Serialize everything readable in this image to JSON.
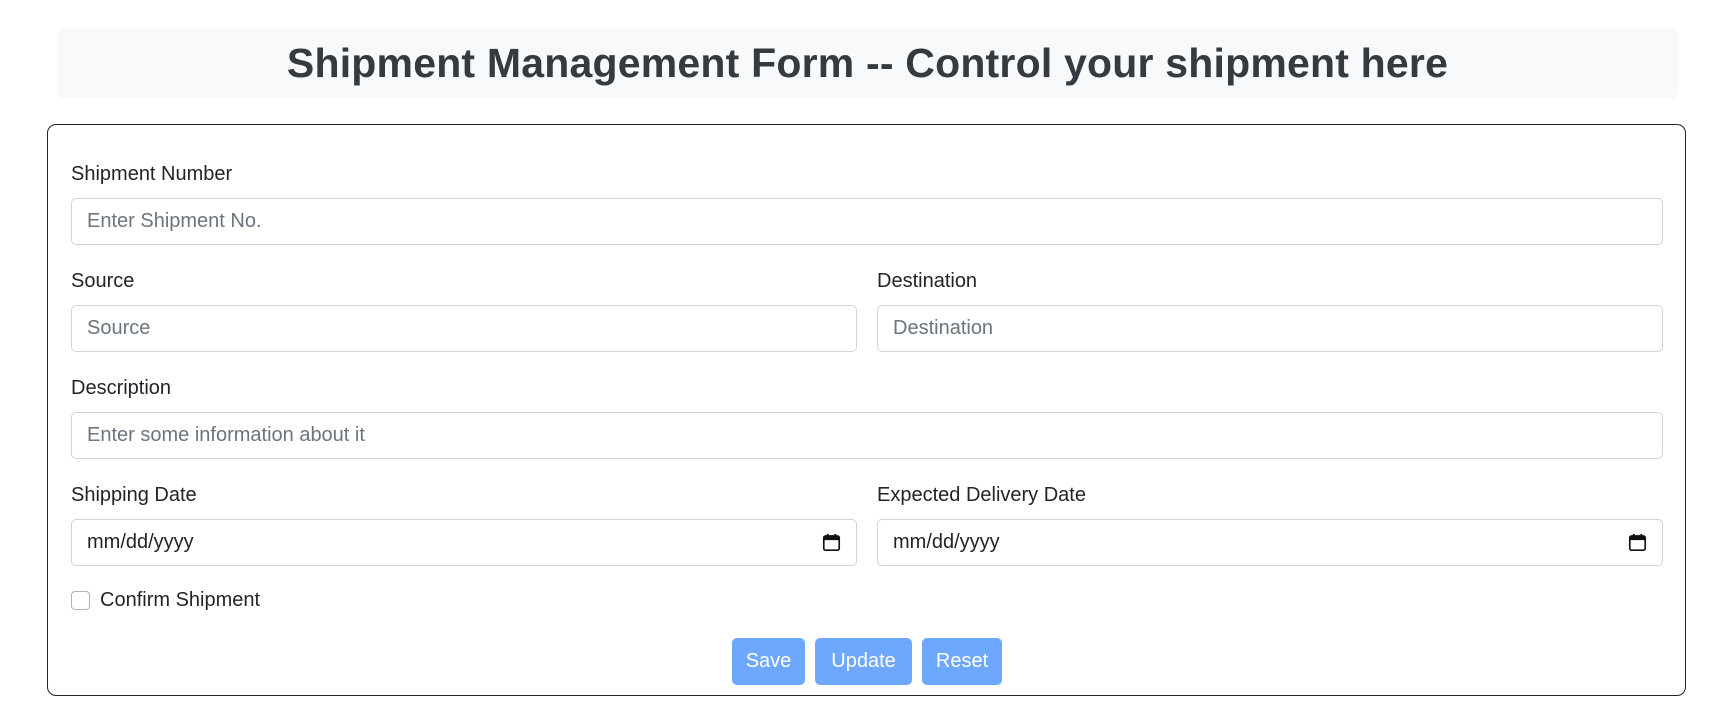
{
  "header": {
    "title": "Shipment Management Form -- Control your shipment here"
  },
  "form": {
    "shipment_number": {
      "label": "Shipment Number",
      "placeholder": "Enter Shipment No.",
      "value": ""
    },
    "source": {
      "label": "Source",
      "placeholder": "Source",
      "value": ""
    },
    "destination": {
      "label": "Destination",
      "placeholder": "Destination",
      "value": ""
    },
    "description": {
      "label": "Description",
      "placeholder": "Enter some information about it",
      "value": ""
    },
    "shipping_date": {
      "label": "Shipping Date",
      "display": "mm/dd/yyyy",
      "icon": "calendar-icon"
    },
    "expected_delivery_date": {
      "label": "Expected Delivery Date",
      "display": "mm/dd/yyyy",
      "icon": "calendar-icon"
    },
    "confirm_shipment": {
      "label": "Confirm Shipment",
      "checked": false
    },
    "buttons": {
      "save": "Save",
      "update": "Update",
      "reset": "Reset"
    }
  },
  "colors": {
    "header_bg": "#f8f9fa",
    "button_bg": "#6ea8fe",
    "input_border": "#ced4da",
    "card_border": "#212529"
  }
}
